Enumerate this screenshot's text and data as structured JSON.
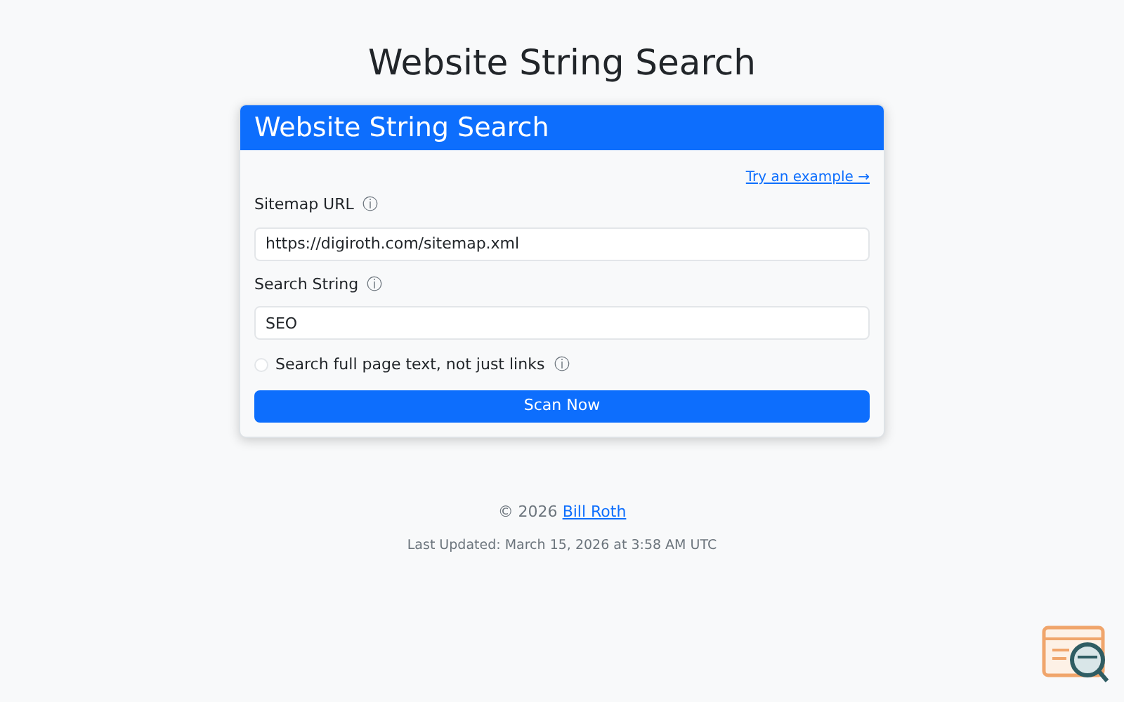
{
  "page_title": "Website String Search",
  "card": {
    "title": "Website String Search",
    "example_link": "Try an example →",
    "fields": [
      {
        "label": "Sitemap URL",
        "info": "ⓘ",
        "value": "https://digiroth.com/sitemap.xml"
      },
      {
        "label": "Search String",
        "info": "ⓘ",
        "value": "SEO"
      }
    ],
    "checkbox": {
      "label": "Search full page text, not just links",
      "info": "ⓘ",
      "checked": false
    },
    "button": "Scan Now"
  },
  "footer": {
    "copyright": "© 2026",
    "author_link": "Bill Roth",
    "last_updated": "Last Updated: March 15, 2026 at 3:58 AM UTC"
  }
}
